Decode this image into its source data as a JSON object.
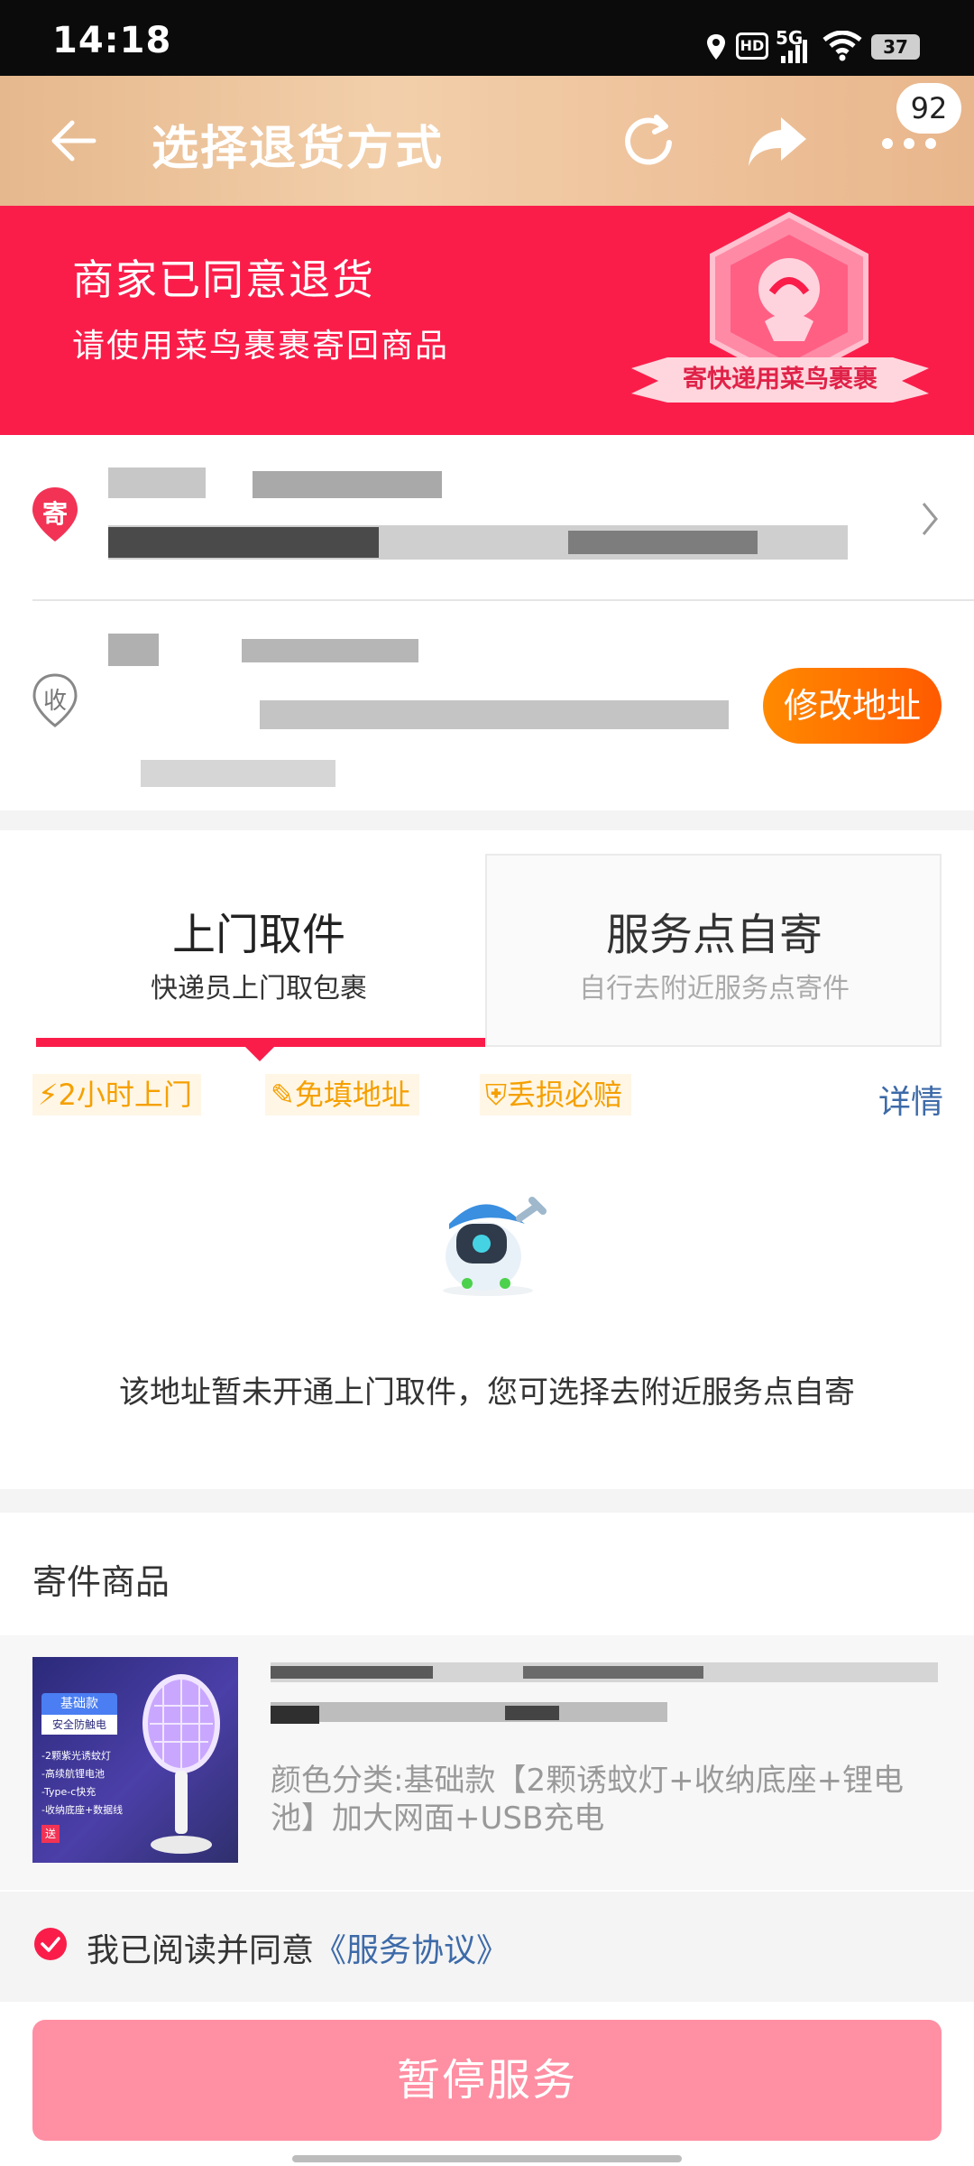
{
  "status_bar": {
    "time": "14:18",
    "network": "5G",
    "hd": "HD",
    "battery": "37"
  },
  "header": {
    "title": "选择退货方式",
    "badge_count": "92"
  },
  "banner": {
    "title": "商家已同意退货",
    "subtitle": "请使用菜鸟裹裹寄回商品",
    "ribbon": "寄快递用菜鸟裹裹"
  },
  "address": {
    "sender_tag": "寄",
    "receiver_tag": "收",
    "modify_label": "修改地址"
  },
  "tabs": [
    {
      "title": "上门取件",
      "subtitle": "快递员上门取包裹",
      "selected": true
    },
    {
      "title": "服务点自寄",
      "subtitle": "自行去附近服务点寄件",
      "selected": false
    }
  ],
  "features": [
    "2小时上门",
    "免填地址",
    "丢损必赔"
  ],
  "detail_label": "详情",
  "notice": "该地址暂未开通上门取件，您可选择去附近服务点自寄",
  "goods": {
    "section_title": "寄件商品",
    "variant": "颜色分类:基础款【2颗诱蚊灯+收纳底座+锂电池】加大网面+USB充电",
    "thumb_tag": "基础款",
    "thumb_tag2": "安全防触电",
    "thumb_lines": [
      "-2颗紫光诱蚊灯",
      "-高续航锂电池",
      "-Type-c快充",
      "-收纳底座+数据线"
    ],
    "thumb_gift": "送"
  },
  "agreement": {
    "text": "我已阅读并同意",
    "link": "《服务协议》"
  },
  "primary_button": "暂停服务"
}
